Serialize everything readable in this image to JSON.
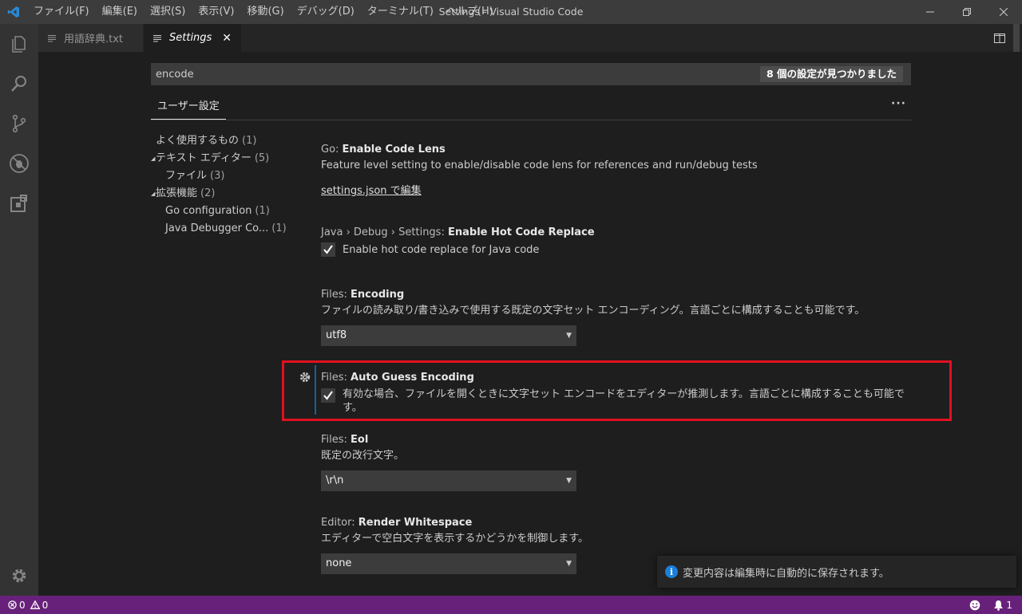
{
  "window": {
    "title": "Settings - Visual Studio Code",
    "menu": [
      "ファイル(F)",
      "編集(E)",
      "選択(S)",
      "表示(V)",
      "移動(G)",
      "デバッグ(D)",
      "ターミナル(T)",
      "ヘルプ(H)"
    ]
  },
  "tabs": [
    {
      "label": "用語辞典.txt",
      "active": false
    },
    {
      "label": "Settings",
      "active": true
    }
  ],
  "settings": {
    "search": {
      "value": "encode",
      "result_count": "8 個の設定が見つかりました"
    },
    "scope_tab": "ユーザー設定",
    "more_label": "···",
    "toc": [
      {
        "label": "よく使用するもの",
        "count": "(1)"
      },
      {
        "label": "テキスト エディター",
        "count": "(5)"
      },
      {
        "label": "ファイル",
        "count": "(3)"
      },
      {
        "label": "拡張機能",
        "count": "(2)"
      },
      {
        "label": "Go configuration",
        "count": "(1)"
      },
      {
        "label": "Java Debugger Co...",
        "count": "(1)"
      }
    ],
    "items": [
      {
        "category": "Go: ",
        "key": "Enable Code Lens",
        "description": "Feature level setting to enable/disable code lens for references and run/debug tests",
        "link": "settings.json で編集"
      },
      {
        "category": "Java › Debug › Settings: ",
        "key": "Enable Hot Code Replace",
        "description": "Enable hot code replace for Java code",
        "checked": true
      },
      {
        "category": "Files: ",
        "key": "Encoding",
        "description": "ファイルの読み取り/書き込みで使用する既定の文字セット エンコーディング。言語ごとに構成することも可能です。",
        "value": "utf8"
      },
      {
        "category": "Files: ",
        "key": "Auto Guess Encoding",
        "description_line1": "有効な場合、ファイルを開くときに文字セット エンコードをエディターが推測します。言語ごとに構成することも可能で",
        "description_line2": "す。",
        "checked": true
      },
      {
        "category": "Files: ",
        "key": "Eol",
        "description": "既定の改行文字。",
        "value": "\\r\\n"
      },
      {
        "category": "Editor: ",
        "key": "Render Whitespace",
        "description": "エディターで空白文字を表示するかどうかを制御します。",
        "value": "none"
      }
    ]
  },
  "notification": {
    "text": "変更内容は編集時に自動的に保存されます。"
  },
  "statusbar": {
    "errors": "0",
    "warnings": "0",
    "notifications": "1"
  },
  "colors": {
    "accent_statusbar": "#68217a",
    "highlight": "#e0111f",
    "info": "#1b80d8"
  }
}
